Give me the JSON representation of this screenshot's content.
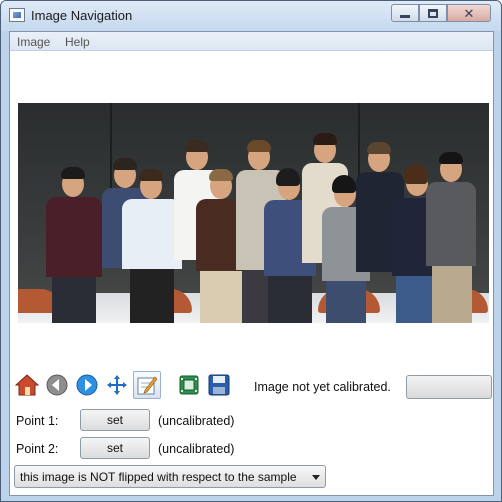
{
  "window": {
    "title": "Image Navigation",
    "controls": {
      "minimize": "minimize-icon",
      "maximize": "maximize-icon",
      "close": "close-icon"
    }
  },
  "menu": {
    "items": [
      "Image",
      "Help"
    ]
  },
  "image": {
    "description_icon": "photo"
  },
  "toolbar": {
    "tools": [
      {
        "icon": "home-icon"
      },
      {
        "icon": "back-arrow-icon"
      },
      {
        "icon": "forward-arrow-icon"
      },
      {
        "icon": "move-icon"
      },
      {
        "icon": "edit-icon",
        "active": true
      },
      {
        "icon": "film-icon"
      },
      {
        "icon": "save-icon"
      }
    ],
    "status": "Image not yet calibrated.",
    "calibrate_button_label": ""
  },
  "points": [
    {
      "label": "Point 1:",
      "button": "set",
      "status": "(uncalibrated)"
    },
    {
      "label": "Point 2:",
      "button": "set",
      "status": "(uncalibrated)"
    }
  ],
  "flip_select": {
    "selected": "this image is NOT flipped with respect to the sample"
  },
  "colors": {
    "titlebar": "#c5d8ee",
    "accent": "#2f6fd0",
    "chair": "#b35a34"
  }
}
